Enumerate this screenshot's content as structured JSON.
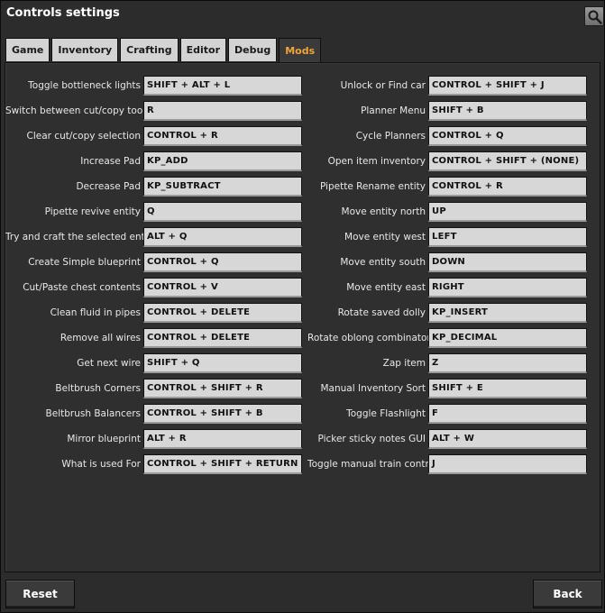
{
  "window": {
    "title": "Controls settings"
  },
  "tabs": [
    {
      "label": "Game"
    },
    {
      "label": "Inventory"
    },
    {
      "label": "Crafting"
    },
    {
      "label": "Editor"
    },
    {
      "label": "Debug"
    },
    {
      "label": "Mods",
      "active": true
    }
  ],
  "accent_color": "#f0a43a",
  "left_bindings": [
    {
      "label": "Toggle bottleneck lights",
      "key": "SHIFT + ALT + L"
    },
    {
      "label": "Switch between cut/copy tools",
      "key": "R"
    },
    {
      "label": "Clear cut/copy selection",
      "key": "CONTROL + R"
    },
    {
      "label": "Increase Pad",
      "key": "KP_ADD"
    },
    {
      "label": "Decrease Pad",
      "key": "KP_SUBTRACT"
    },
    {
      "label": "Pipette revive entity",
      "key": "Q"
    },
    {
      "label": "Try and craft the selected entity",
      "key": "ALT + Q"
    },
    {
      "label": "Create Simple blueprint",
      "key": "CONTROL + Q"
    },
    {
      "label": "Cut/Paste chest contents",
      "key": "CONTROL + V"
    },
    {
      "label": "Clean fluid in pipes",
      "key": "CONTROL + DELETE"
    },
    {
      "label": "Remove all wires",
      "key": "CONTROL + DELETE"
    },
    {
      "label": "Get next wire",
      "key": "SHIFT + Q"
    },
    {
      "label": "Beltbrush Corners",
      "key": "CONTROL + SHIFT + R"
    },
    {
      "label": "Beltbrush Balancers",
      "key": "CONTROL + SHIFT + B"
    },
    {
      "label": "Mirror blueprint",
      "key": "ALT + R"
    },
    {
      "label": "What is used For",
      "key": "CONTROL + SHIFT + RETURN"
    }
  ],
  "right_bindings": [
    {
      "label": "Unlock or Find car",
      "key": "CONTROL + SHIFT + J"
    },
    {
      "label": "Planner Menu",
      "key": "SHIFT + B"
    },
    {
      "label": "Cycle Planners",
      "key": "CONTROL + Q"
    },
    {
      "label": "Open item inventory",
      "key": "CONTROL + SHIFT + (NONE)"
    },
    {
      "label": "Pipette Rename entity",
      "key": "CONTROL + R"
    },
    {
      "label": "Move entity north",
      "key": "UP"
    },
    {
      "label": "Move entity west",
      "key": "LEFT"
    },
    {
      "label": "Move entity south",
      "key": "DOWN"
    },
    {
      "label": "Move entity east",
      "key": "RIGHT"
    },
    {
      "label": "Rotate saved dolly",
      "key": "KP_INSERT"
    },
    {
      "label": "Rotate oblong combinator",
      "key": "KP_DECIMAL"
    },
    {
      "label": "Zap item",
      "key": "Z"
    },
    {
      "label": "Manual Inventory Sort",
      "key": "SHIFT + E"
    },
    {
      "label": "Toggle Flashlight",
      "key": "F"
    },
    {
      "label": "Picker sticky notes GUI",
      "key": "ALT + W"
    },
    {
      "label": "Toggle manual train control",
      "key": "J"
    }
  ],
  "footer": {
    "reset_label": "Reset",
    "back_label": "Back"
  },
  "icons": {
    "search": "search-icon"
  }
}
